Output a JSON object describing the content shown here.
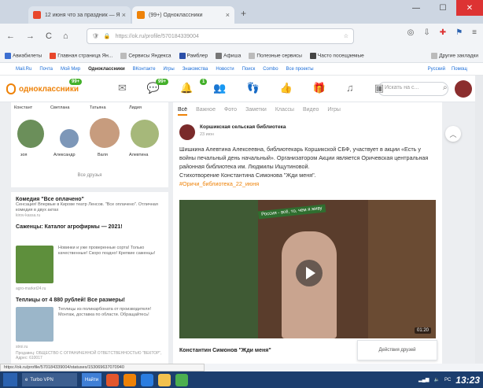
{
  "browser": {
    "tabs": [
      {
        "title": "12 июня что за праздник — Я",
        "active": false,
        "favicon_color": "#e8462b"
      },
      {
        "title": "(99+) Одноклассники",
        "active": true,
        "favicon_color": "#ee8208"
      }
    ],
    "new_tab": "+",
    "controls": {
      "minimize": "—",
      "maximize": "☐",
      "close": "✕"
    },
    "url": "https://ok.ru/profile/570184339004",
    "nav": {
      "back": "←",
      "forward": "→",
      "reload": "C",
      "home": "⌂"
    }
  },
  "bookmarks": [
    "Авиабилеты",
    "Главная страница Ян...",
    "Сервисы Яндекса",
    "Рамблер",
    "Афиша",
    "Полезные сервисы",
    "Часто посещаемые",
    "Другие закладки"
  ],
  "mailbar": {
    "items": [
      "Mail.Ru",
      "Почта",
      "Мой Мир",
      "Одноклассники",
      "ВКонтакте",
      "Игры",
      "Знакомства",
      "Новости",
      "Поиск",
      "Combo",
      "Все проекты"
    ],
    "active": "Одноклассники",
    "right": [
      "Русский",
      "Помощ"
    ]
  },
  "ok": {
    "logo": "одноклассники",
    "badges": {
      "messages": "99+",
      "discussions": "99+",
      "notifications": "1"
    },
    "search_placeholder": "Искать на с..."
  },
  "friends": {
    "row1": [
      "Констант",
      "Светлана",
      "Татьяна",
      "Лидия"
    ],
    "row2": [
      "зоя",
      "Александр",
      "Валя",
      "Алевтина"
    ],
    "all": "Все друзья"
  },
  "ads": [
    {
      "title": "Комедия \"Все оплачено\"",
      "text": "Сенсация! Впервые в Кирове театр Ленсов. \"Все оплачено\". Отличная комедия в двух актах",
      "source": "kirov-kassa.ru"
    },
    {
      "title": "Саженцы: Каталог агрофирмы — 2021!",
      "text": "Новинки и уже проверенные сорта! Только качественные! Скоро поздно! Крепкие саженцы!",
      "source": "agro-market24.ru"
    },
    {
      "title": "Теплицы от 4 880 рублей! Все размеры!",
      "text": "Теплицы из поликарбоната от производителя! Монтаж, доставка по области. Обращайтесь!",
      "source": "stroi.ru"
    }
  ],
  "ad_footer": "Продавец: ОБЩЕСТВО С ОГРАНИЧЕННОЙ ОТВЕТСТВЕННОСТЬЮ \"ВЕКТОР\", Адрес: 610017",
  "feed": {
    "tabs": [
      "Всё",
      "Важное",
      "Фото",
      "Заметки",
      "Классы",
      "Видео",
      "Игры"
    ],
    "active_tab": "Всё",
    "post": {
      "author": "Коршикская сельская библиотека",
      "date": "23 июн",
      "text": "Шишкина Алевтина Алексеевна, библиотекарь Коршикской СБФ, участвует в акции «Есть у войны печальный день начальный». Организатором Акции является Оричевская центральная районная библиотека им. Людмилы Ищутиновой.",
      "text2": "Стихотворение Константина Симонова \"Жди меня\".",
      "hashtag": "#Оричи_библиотека_22_июня",
      "video_caption": "Россия - всё, то, чем я живу",
      "video_time": "01:20",
      "video_title": "Константин Симонов \"Жди меня\""
    }
  },
  "friends_actions": "Действия друзей",
  "status_url": "https://ok.ru/profile/570184339004/statuses/153069637070940",
  "taskbar": {
    "vpn": "Turbo VPN",
    "button": "Найти",
    "tray_lang": "РС",
    "clock": "13:23"
  }
}
